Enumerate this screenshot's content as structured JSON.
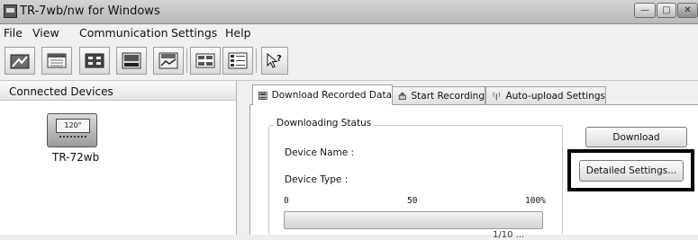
{
  "window": {
    "title": "TR-7wb/nw for Windows",
    "controls": [
      "minimize",
      "maximize",
      "close"
    ]
  },
  "menu": {
    "items": [
      "File",
      "View",
      "Communication",
      "Settings",
      "Help"
    ]
  },
  "toolbar": {
    "buttons": [
      {
        "icon": "twd-device-icon"
      },
      {
        "icon": "data-table-icon"
      },
      {
        "icon": "readings-icon"
      },
      {
        "icon": "warning-device-icon"
      },
      {
        "icon": "now-monitor-icon"
      },
      {
        "icon": "split-view-icon"
      },
      {
        "icon": "list-view-icon"
      },
      {
        "icon": "help-cursor-icon"
      }
    ]
  },
  "left_panel": {
    "title": "Connected Devices",
    "device": {
      "screen": "120°",
      "label": "TR-72wb"
    }
  },
  "tabs": [
    {
      "label": "Download Recorded Data",
      "active": true
    },
    {
      "label": "Start Recording",
      "active": false
    },
    {
      "label": "Auto-upload Settings",
      "active": false
    }
  ],
  "download_status": {
    "group_title": "Downloading Status",
    "device_name_label": "Device Name :",
    "device_type_label": "Device Type :",
    "progress_min": "0",
    "progress_mid": "50",
    "progress_max": "100%",
    "progress_value": 0,
    "partial_text": "1/10 ..."
  },
  "buttons": {
    "download": "Download",
    "detailed_settings": "Detailed Settings..."
  },
  "colors": {
    "highlight_border": "#000000"
  }
}
